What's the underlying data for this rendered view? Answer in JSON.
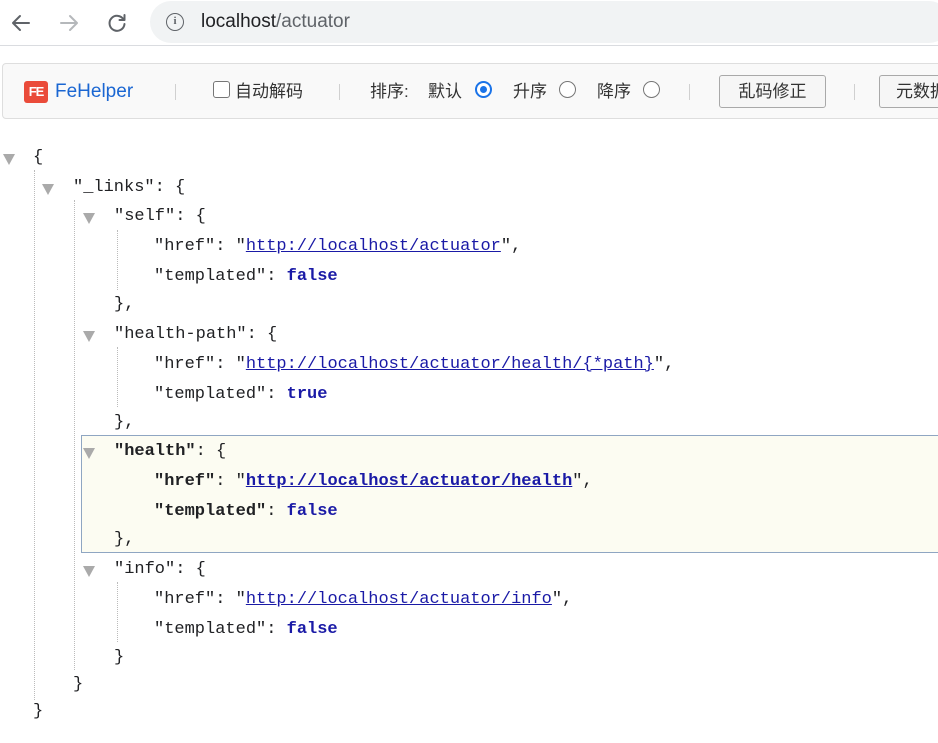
{
  "browser": {
    "url_host": "localhost",
    "url_path": "/actuator",
    "icons": {
      "back": "arrow-left-icon",
      "forward": "arrow-right-icon",
      "reload": "reload-icon",
      "site_info": "info-icon"
    }
  },
  "fehelper": {
    "logo_text": "FE",
    "name": "FeHelper",
    "auto_decode_label": "自动解码",
    "auto_decode_checked": false,
    "sort_label": "排序:",
    "sort_options": [
      {
        "label": "默认",
        "selected": true
      },
      {
        "label": "升序",
        "selected": false
      },
      {
        "label": "降序",
        "selected": false
      }
    ],
    "fix_encoding_button": "乱码修正",
    "meta_button": "元数据"
  },
  "json_view": {
    "open_root": "{",
    "links_key": "\"_links\"",
    "sections": [
      {
        "key": "\"self\"",
        "href_key": "\"href\"",
        "href": "http://localhost/actuator",
        "templated_key": "\"templated\"",
        "templated": "false",
        "close": "},"
      },
      {
        "key": "\"health-path\"",
        "href_key": "\"href\"",
        "href": "http://localhost/actuator/health/{*path}",
        "templated_key": "\"templated\"",
        "templated": "true",
        "close": "},"
      },
      {
        "key": "\"health\"",
        "href_key": "\"href\"",
        "href": "http://localhost/actuator/health",
        "templated_key": "\"templated\"",
        "templated": "false",
        "close": "},"
      },
      {
        "key": "\"info\"",
        "href_key": "\"href\"",
        "href": "http://localhost/actuator/info",
        "templated_key": "\"templated\"",
        "templated": "false",
        "close": "}"
      }
    ],
    "close_links": "}",
    "close_root": "}",
    "highlighted_section": "\"health\""
  }
}
